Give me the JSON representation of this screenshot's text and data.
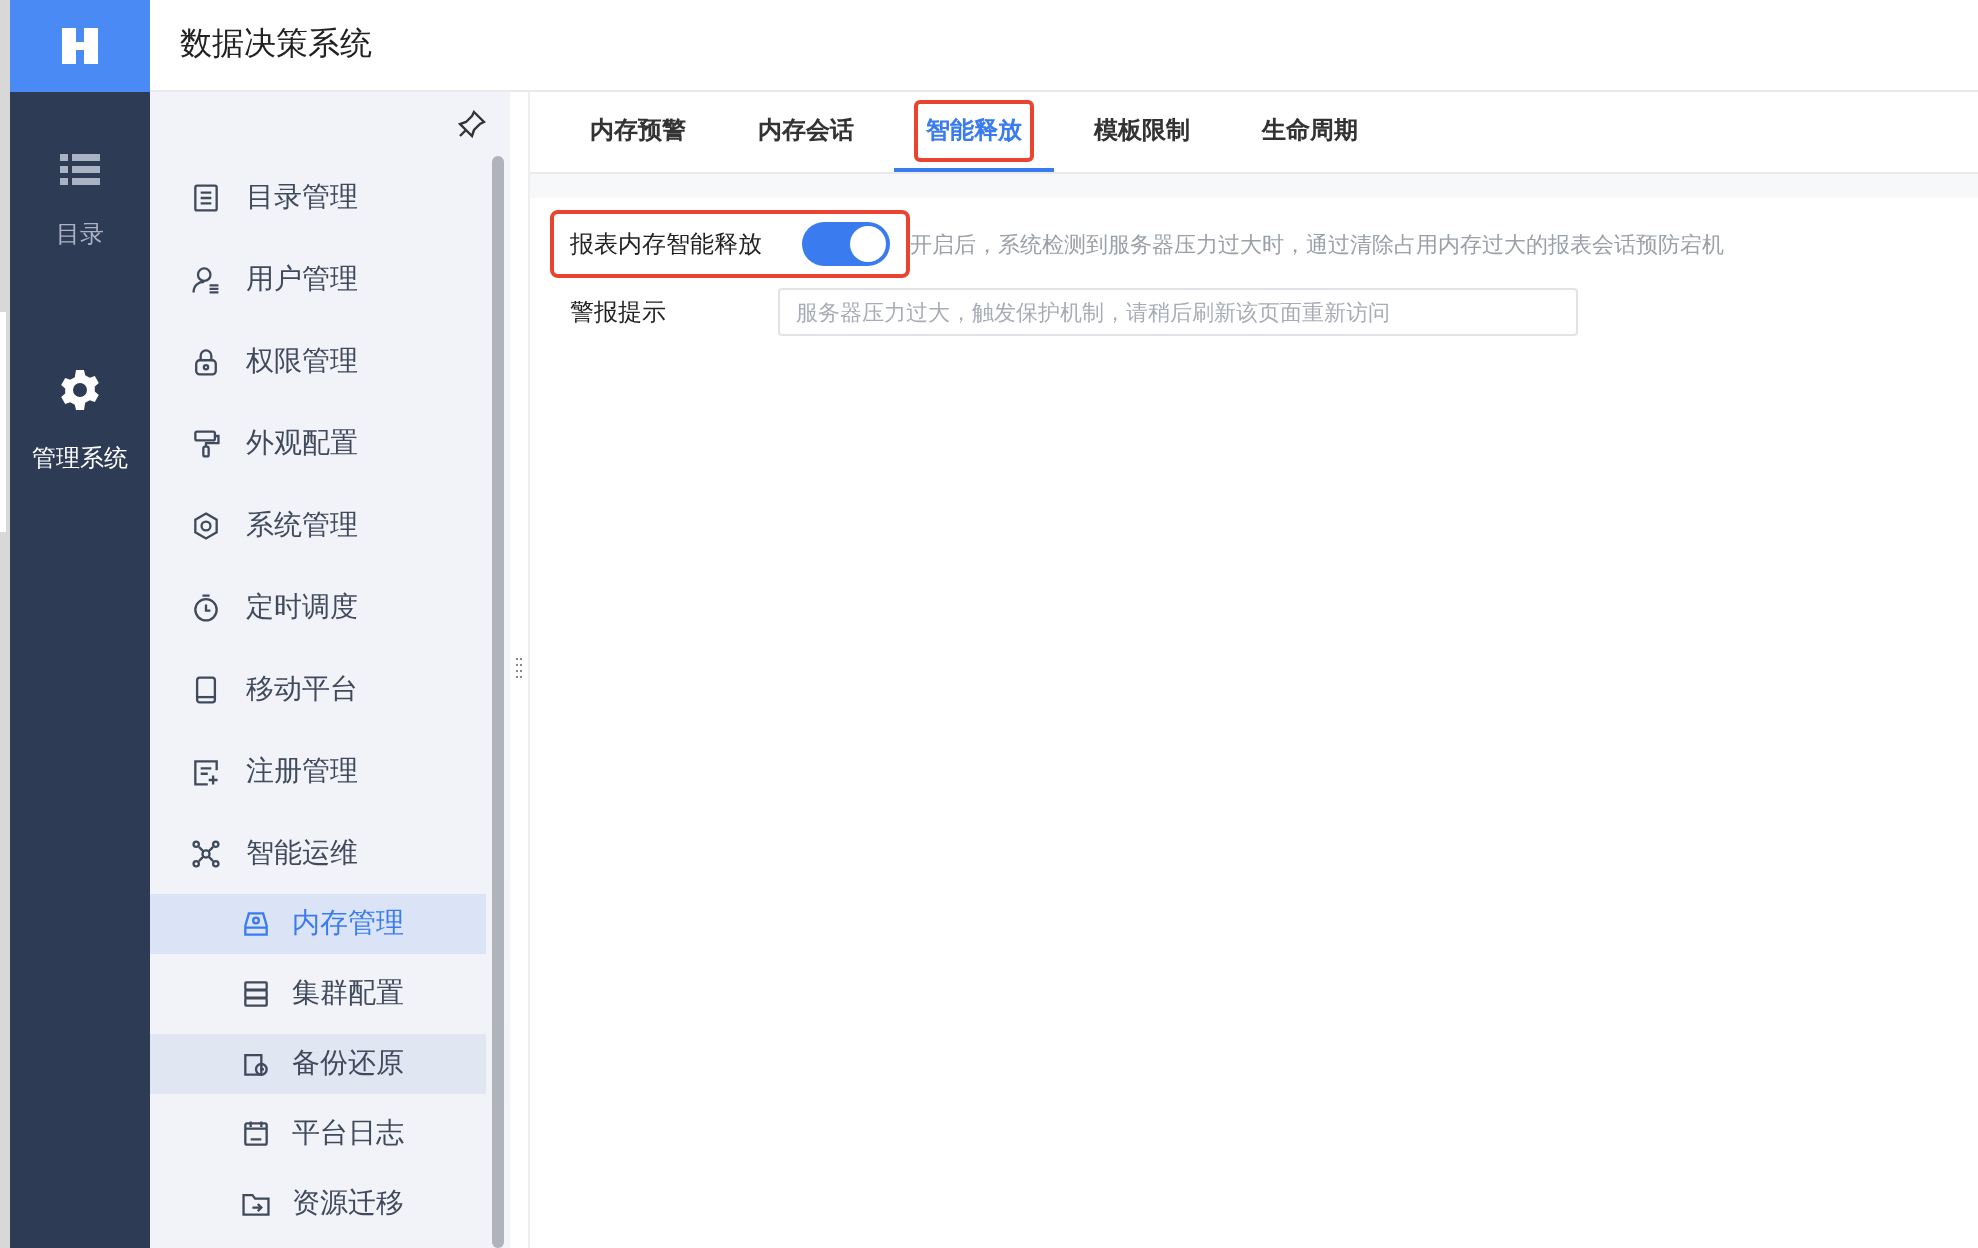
{
  "app": {
    "title": "数据决策系统"
  },
  "rail": [
    {
      "label": "目录",
      "selected": false
    },
    {
      "label": "管理系统",
      "selected": true
    }
  ],
  "sidebar": {
    "items": [
      {
        "label": "目录管理",
        "selected": false,
        "hovered": false
      },
      {
        "label": "用户管理",
        "selected": false,
        "hovered": false
      },
      {
        "label": "权限管理",
        "selected": false,
        "hovered": false
      },
      {
        "label": "外观配置",
        "selected": false,
        "hovered": false
      },
      {
        "label": "系统管理",
        "selected": false,
        "hovered": false
      },
      {
        "label": "定时调度",
        "selected": false,
        "hovered": false
      },
      {
        "label": "移动平台",
        "selected": false,
        "hovered": false
      },
      {
        "label": "注册管理",
        "selected": false,
        "hovered": false
      },
      {
        "label": "智能运维",
        "selected": false,
        "hovered": false,
        "expanded": true,
        "children": [
          {
            "label": "内存管理",
            "selected": true,
            "hovered": false
          },
          {
            "label": "集群配置",
            "selected": false,
            "hovered": false
          },
          {
            "label": "备份还原",
            "selected": false,
            "hovered": true
          },
          {
            "label": "平台日志",
            "selected": false,
            "hovered": false
          },
          {
            "label": "资源迁移",
            "selected": false,
            "hovered": false
          }
        ]
      }
    ]
  },
  "tabs": [
    {
      "label": "内存预警",
      "selected": false,
      "highlighted": false
    },
    {
      "label": "内存会话",
      "selected": false,
      "highlighted": false
    },
    {
      "label": "智能释放",
      "selected": true,
      "highlighted": true
    },
    {
      "label": "模板限制",
      "selected": false,
      "highlighted": false
    },
    {
      "label": "生命周期",
      "selected": false,
      "highlighted": false
    }
  ],
  "settings": [
    {
      "kind": "toggle",
      "label": "报表内存智能释放",
      "on": true,
      "highlighted": true,
      "description": "开启后，系统检测到服务器压力过大时，通过清除占用内存过大的报表会话预防宕机"
    },
    {
      "kind": "text",
      "label": "警报提示",
      "placeholder": "服务器压力过大，触发保护机制，请稍后刷新该页面重新访问"
    }
  ]
}
